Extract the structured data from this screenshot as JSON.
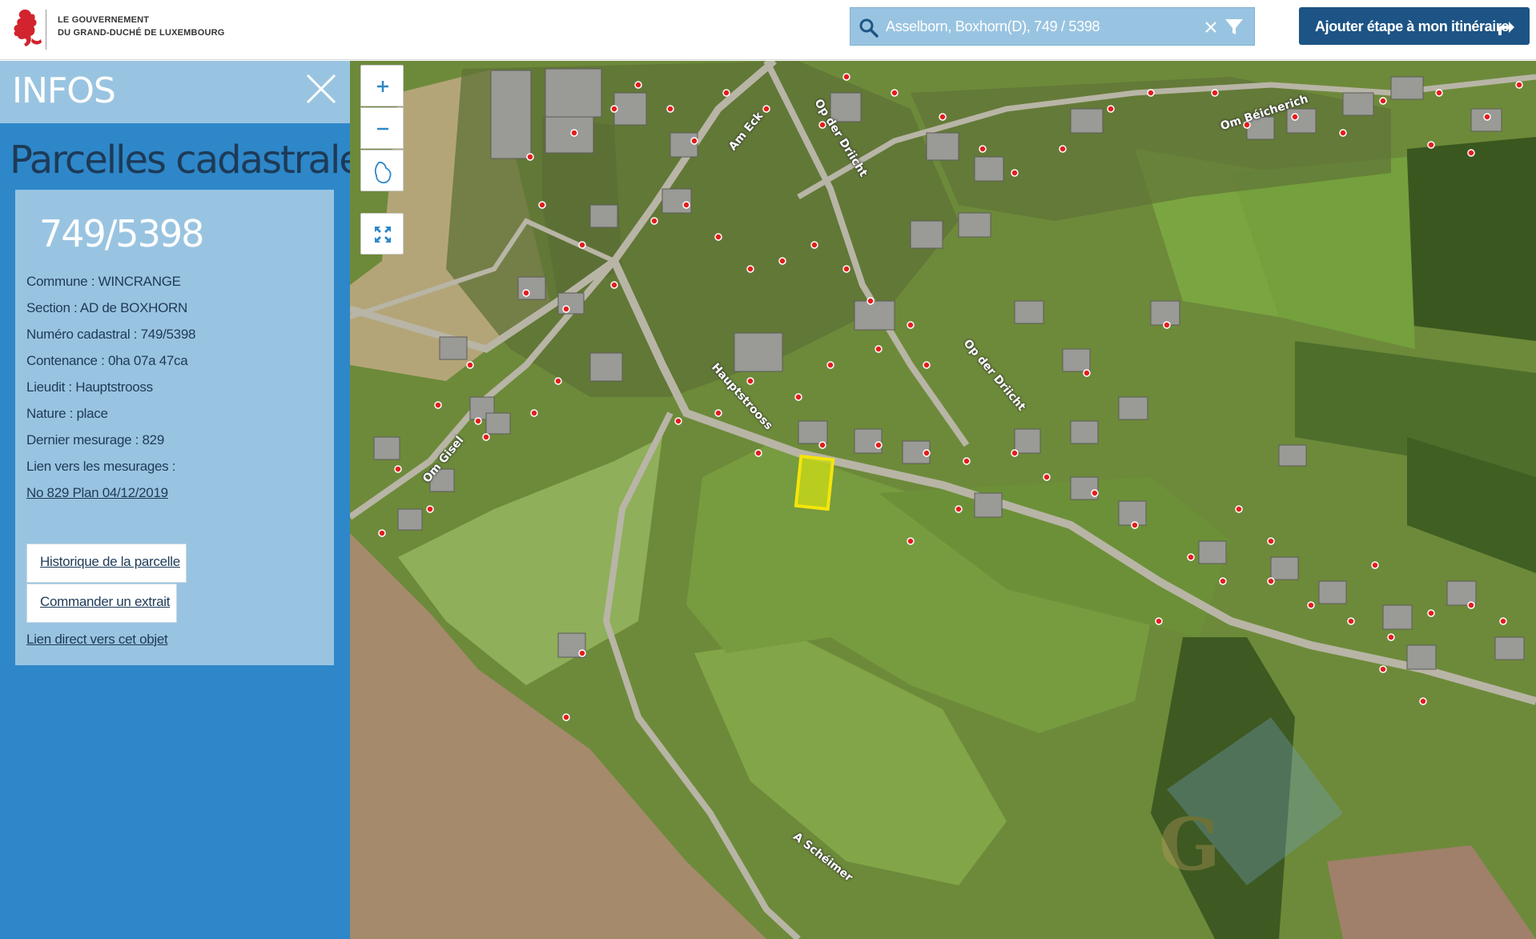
{
  "header": {
    "logo_line1": "Le Gouvernement",
    "logo_line2": "du Grand-Duché de Luxembourg",
    "search_value": "Asselborn, Boxhorn(D), 749 / 5398",
    "route_button": "Ajouter étape à mon itinéraire"
  },
  "sidebar": {
    "title": "INFOS",
    "panel_title": "Parcelles cadastrales",
    "parcel": {
      "number": "749/5398",
      "commune": "Commune : WINCRANGE",
      "section": "Section : AD de BOXHORN",
      "numero": "Numéro cadastral : 749/5398",
      "contenance": "Contenance : 0ha 07a 47ca",
      "lieudit": "Lieudit : Hauptstrooss",
      "nature": "Nature : place",
      "dernier": "Dernier mesurage : 829",
      "lien_label": "Lien vers les mesurages :",
      "mesurage_link": "No 829 Plan 04/12/2019",
      "historique_button": "Historique de la parcelle",
      "commander_button": "Commander un extrait",
      "direct_link": "Lien direct vers cet objet"
    }
  },
  "map": {
    "streets": {
      "am_eck": "Am Eck",
      "op_der_driicht_1": "Op der Driicht",
      "om_beicherich": "Om Béicherich",
      "op_der_driicht_2": "Op der Driicht",
      "hauptstrooss": "Hauptstrooss",
      "om_gisel": "Om Gisel",
      "a_scheimer": "A Schéimer"
    },
    "watermark": "G"
  },
  "colors": {
    "header_button": "#1d5485",
    "sidebar_bg": "#2e87c8",
    "sidebar_light": "#99c4e1",
    "text_dark": "#1d3a57",
    "parcel_highlight": "#f5e50a"
  },
  "icons": {
    "search": "search-icon",
    "clear": "close-icon",
    "filter": "filter-icon",
    "route": "turn-right-arrow-icon",
    "zoom_in": "plus-icon",
    "zoom_out": "minus-icon",
    "country": "luxembourg-outline-icon",
    "fullscreen": "expand-icon",
    "close": "close-icon"
  }
}
